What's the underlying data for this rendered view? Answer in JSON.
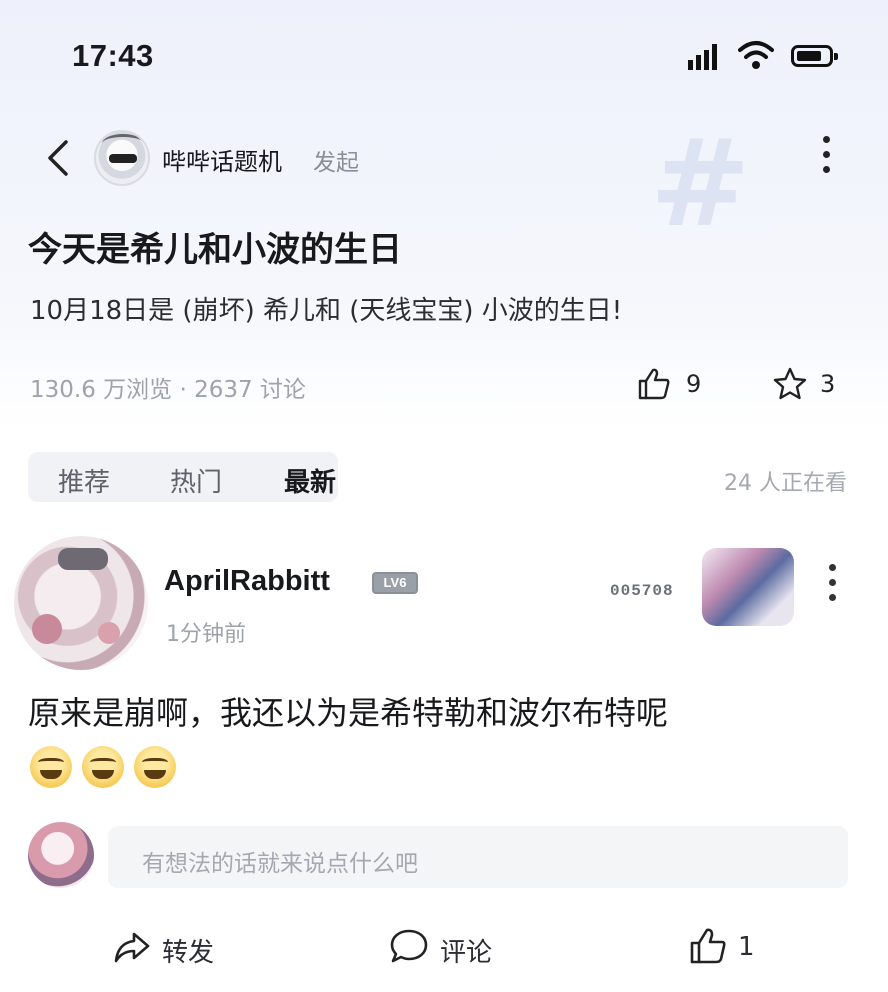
{
  "status_bar": {
    "time": "17:43"
  },
  "nav": {
    "topic_name": "哔哔话题机",
    "topic_action": "发起"
  },
  "post": {
    "title": "今天是希儿和小波的生日",
    "description": "10月18日是 (崩坏) 希儿和 (天线宝宝) 小波的生日!",
    "stats": "130.6 万浏览 · 2637 讨论",
    "likes": "9",
    "favorites": "3"
  },
  "tabs": {
    "items": [
      {
        "label": "推荐"
      },
      {
        "label": "热门"
      },
      {
        "label": "最新"
      }
    ],
    "selected": "最新",
    "watching": "24 人正在看"
  },
  "comment": {
    "username": "AprilRabbitt",
    "level": "LV6",
    "time_ago": "1分钟前",
    "fan_number": "005708",
    "text": "原来是崩啊，我还以为是希特勒和波尔布特呢",
    "emojis": [
      "laughing-face",
      "laughing-face",
      "laughing-face"
    ]
  },
  "reply": {
    "placeholder": "有想法的话就来说点什么吧"
  },
  "bottom_bar": {
    "share_label": "转发",
    "comment_label": "评论",
    "like_count": "1"
  }
}
